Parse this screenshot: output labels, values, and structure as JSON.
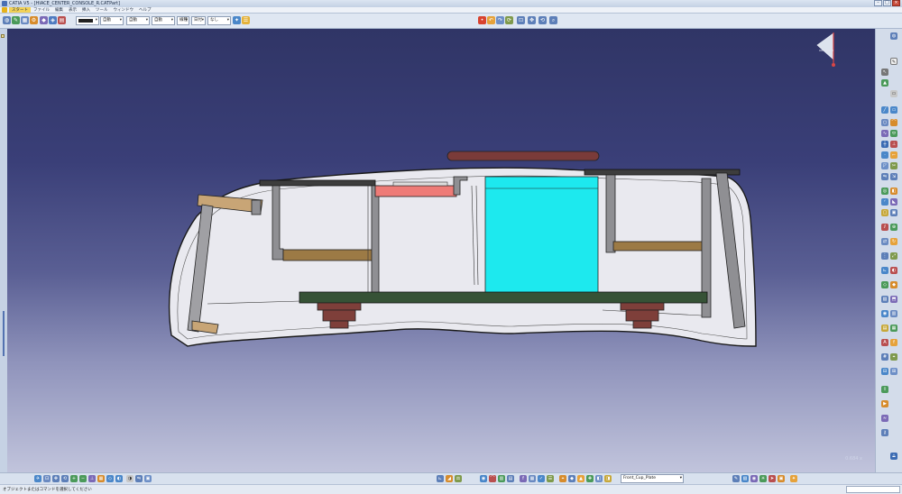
{
  "window": {
    "title": "CATIA V5 - [HIACE_CENTER_CONSOLE_R.CATPart]"
  },
  "menu": [
    "スタート",
    "ファイル",
    "編集",
    "表示",
    "挿入",
    "ツール",
    "ウィンドウ",
    "ヘルプ"
  ],
  "toolbar": {
    "line_color": "#1f1f1f",
    "line_weight": "自動",
    "line_type": "自動",
    "point": "自動",
    "layer": "自動",
    "render": "線種",
    "filter": "日付",
    "none": "なし"
  },
  "bottom": {
    "current_part": "Front_Cup_Plate"
  },
  "viewport": {
    "zoom_label": "0.684 x"
  },
  "status": {
    "prompt": "オブジェクトまたはコマンドを選択してください"
  },
  "colors": {
    "frame": "#e9e9ef",
    "wall": "#8f8f93",
    "wood": "#c8a576",
    "bracket": "#9c7a45",
    "bar_red": "#7a3b39",
    "bar_dark": "#3d3d3d",
    "pink": "#ee7b77",
    "cyan": "#1de9ee",
    "base": "#365236",
    "foot": "#7e3f3a"
  },
  "icons": {
    "compass": "compass-icon",
    "close": "close-icon",
    "minimize": "minimize-icon",
    "maximize": "maximize-icon",
    "catia_logo": "catia-logo-icon"
  }
}
